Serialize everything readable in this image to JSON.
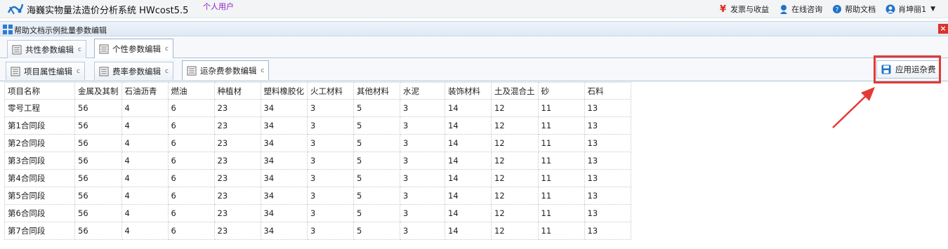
{
  "app": {
    "title": "海巍实物量法造价分析系统 HWcost5.5",
    "user_type": "个人用户"
  },
  "topbar": {
    "invoice": "发票与收益",
    "consult": "在线咨询",
    "help": "帮助文档",
    "user": "肖坤丽1",
    "yen_symbol": "¥",
    "caret": "▼"
  },
  "panel": {
    "title": "帮助文档示例批量参数编辑",
    "close": "×"
  },
  "tabs_row1": [
    {
      "label": "共性参数编辑",
      "active": false
    },
    {
      "label": "个性参数编辑",
      "active": true
    }
  ],
  "tabs_row2": [
    {
      "label": "项目属性编辑",
      "active": false
    },
    {
      "label": "费率参数编辑",
      "active": false
    },
    {
      "label": "运杂费参数编辑",
      "active": true
    }
  ],
  "refresh_glyph": "c",
  "apply_button": {
    "label": "应用运杂费"
  },
  "table": {
    "columns": [
      "项目名称",
      "金属及其制",
      "石油沥青",
      "燃油",
      "种植材",
      "塑料橡胶化",
      "火工材料",
      "其他材料",
      "水泥",
      "装饰材料",
      "土及混合土",
      "砂",
      "石料"
    ],
    "rows": [
      [
        "零号工程",
        "56",
        "4",
        "6",
        "23",
        "34",
        "3",
        "5",
        "3",
        "14",
        "12",
        "11",
        "13"
      ],
      [
        "第1合同段",
        "56",
        "4",
        "6",
        "23",
        "34",
        "3",
        "5",
        "3",
        "14",
        "12",
        "11",
        "13"
      ],
      [
        "第2合同段",
        "56",
        "4",
        "6",
        "23",
        "34",
        "3",
        "5",
        "3",
        "14",
        "12",
        "11",
        "13"
      ],
      [
        "第3合同段",
        "56",
        "4",
        "6",
        "23",
        "34",
        "3",
        "5",
        "3",
        "14",
        "12",
        "11",
        "13"
      ],
      [
        "第4合同段",
        "56",
        "4",
        "6",
        "23",
        "34",
        "3",
        "5",
        "3",
        "14",
        "12",
        "11",
        "13"
      ],
      [
        "第5合同段",
        "56",
        "4",
        "6",
        "23",
        "34",
        "3",
        "5",
        "3",
        "14",
        "12",
        "11",
        "13"
      ],
      [
        "第6合同段",
        "56",
        "4",
        "6",
        "23",
        "34",
        "3",
        "5",
        "3",
        "14",
        "12",
        "11",
        "13"
      ],
      [
        "第7合同段",
        "56",
        "4",
        "6",
        "23",
        "34",
        "3",
        "5",
        "3",
        "14",
        "12",
        "11",
        "13"
      ]
    ]
  },
  "colors": {
    "accent_blue": "#1e73c8",
    "highlight_red": "#e53935",
    "user_type_purple": "#8a1ec8"
  }
}
